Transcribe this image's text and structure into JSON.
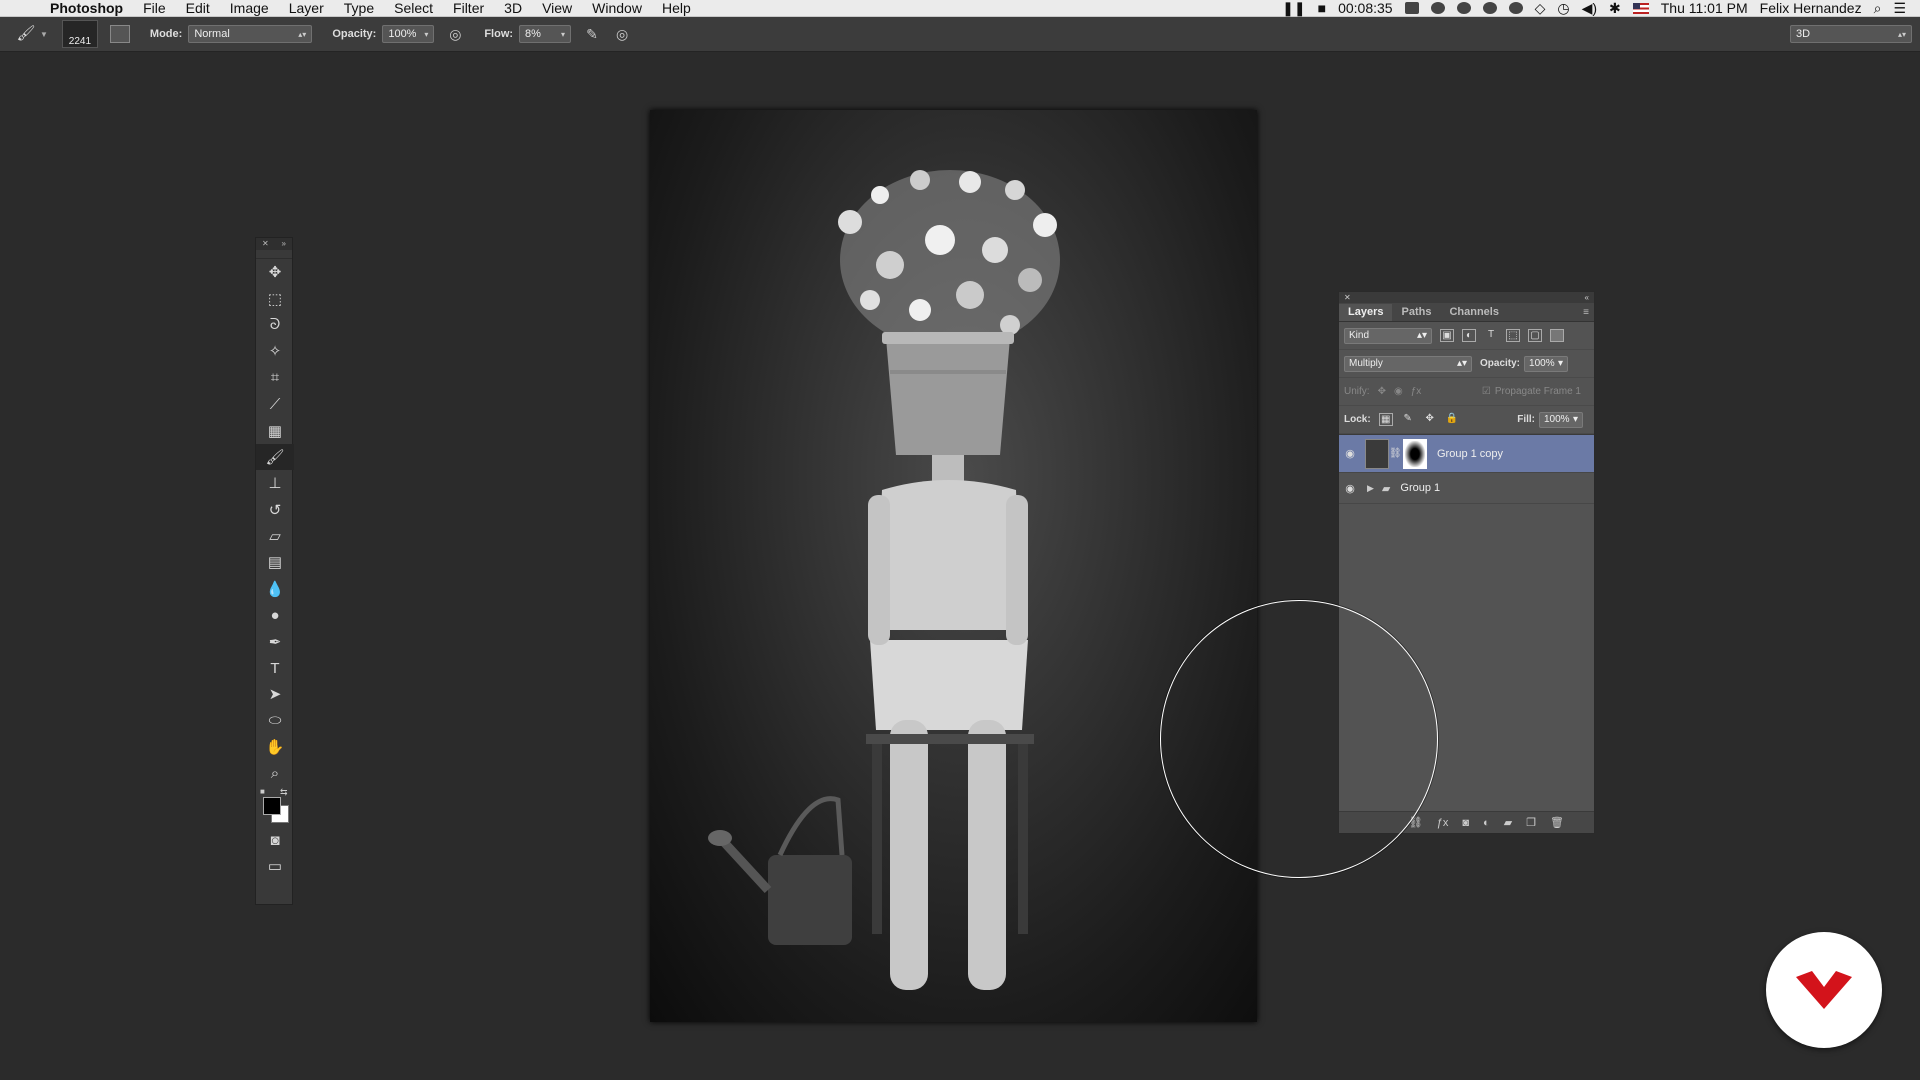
{
  "menubar": {
    "app_name": "Photoshop",
    "menus": [
      "File",
      "Edit",
      "Image",
      "Layer",
      "Type",
      "Select",
      "Filter",
      "3D",
      "View",
      "Window",
      "Help"
    ],
    "recording_time": "00:08:35",
    "clock": "Thu 11:01 PM",
    "user": "Felix Hernandez"
  },
  "options_bar": {
    "brush_size": "2241",
    "mode_label": "Mode:",
    "mode_value": "Normal",
    "opacity_label": "Opacity:",
    "opacity_value": "100%",
    "flow_label": "Flow:",
    "flow_value": "8%",
    "workspace": "3D"
  },
  "toolbox": {
    "tools": [
      "move-tool",
      "marquee-tool",
      "lasso-tool",
      "quick-selection-tool",
      "crop-tool",
      "eyedropper-tool",
      "healing-brush-tool",
      "brush-tool",
      "clone-stamp-tool",
      "history-brush-tool",
      "eraser-tool",
      "gradient-tool",
      "blur-tool",
      "dodge-tool",
      "pen-tool",
      "type-tool",
      "path-selection-tool",
      "ellipse-tool",
      "hand-tool",
      "zoom-tool"
    ],
    "active_tool": "brush-tool",
    "foreground_color": "#000000",
    "background_color": "#ffffff"
  },
  "layers_panel": {
    "tabs": [
      "Layers",
      "Paths",
      "Channels"
    ],
    "active_tab": "Layers",
    "filter_kind": "Kind",
    "blend_mode": "Multiply",
    "opacity_label": "Opacity:",
    "opacity_value": "100%",
    "unify_label": "Unify:",
    "propagate_label": "Propagate Frame 1",
    "lock_label": "Lock:",
    "fill_label": "Fill:",
    "fill_value": "100%",
    "layers": [
      {
        "name": "Group 1 copy",
        "selected": true
      },
      {
        "name": "Group 1",
        "selected": false
      }
    ]
  },
  "colors": {
    "selected_layer": "#6b7aa6",
    "logo_red": "#d3131b"
  }
}
